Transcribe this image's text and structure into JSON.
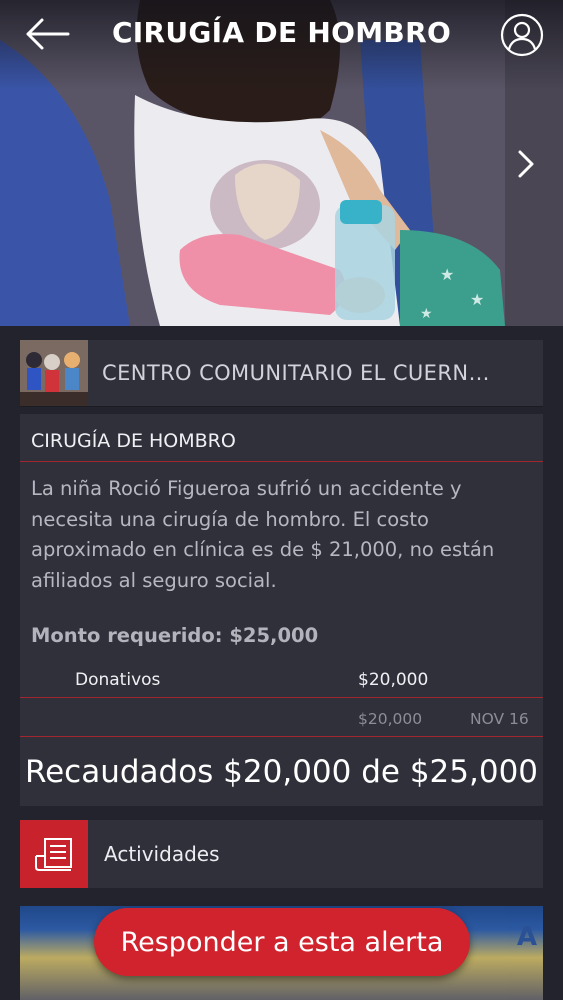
{
  "header": {
    "title": "CIRUGÍA DE HOMBRO",
    "back_icon": "arrow-left-icon",
    "profile_icon": "user-profile-icon",
    "next_icon": "chevron-right-icon"
  },
  "organization": {
    "name": "CENTRO COMUNITARIO EL CUERN…"
  },
  "alert": {
    "title": "CIRUGÍA DE HOMBRO",
    "description": "La niña Roció Figueroa sufrió un accidente y necesita una cirugía de hombro. El costo aproximado en clínica es de $ 21,000, no están afiliados al seguro social.",
    "required_amount": "Monto requerido: $25,000",
    "donations_label": "Donativos",
    "donations_amount": "$20,000",
    "entry_amount": "$20,000",
    "entry_date": "NOV 16",
    "raised_summary": "Recaudados $20,000 de $25,000"
  },
  "activities": {
    "label": "Actividades",
    "icon": "document-list-icon"
  },
  "preview": {
    "text": "A"
  },
  "cta": {
    "label": "Responder a esta alerta"
  },
  "colors": {
    "background": "#23232d",
    "card": "#30303b",
    "accent": "#d0232e",
    "divider": "#a2262d"
  }
}
